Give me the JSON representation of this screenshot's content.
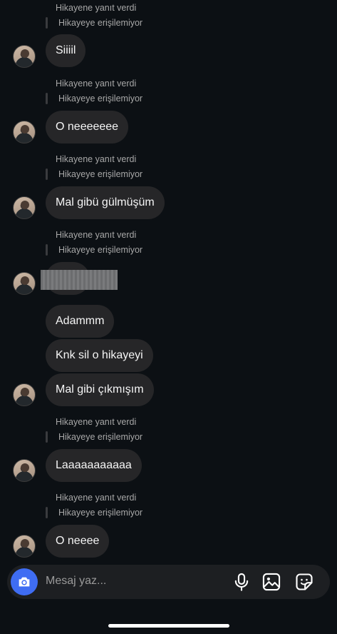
{
  "messages": [
    {
      "type": "story_reply",
      "reply": "Hikayene yanıt verdi",
      "unavailable": "Hikayeye erişilemiyor",
      "text": "Siiiil"
    },
    {
      "type": "story_reply",
      "reply": "Hikayene yanıt verdi",
      "unavailable": "Hikayeye erişilemiyor",
      "text": "O neeeeeee"
    },
    {
      "type": "story_reply",
      "reply": "Hikayene yanıt verdi",
      "unavailable": "Hikayeye erişilemiyor",
      "text": "Mal gibü gülmüşüm"
    },
    {
      "type": "story_reply",
      "reply": "Hikayene yanıt verdi",
      "unavailable": "Hikayeye erişilemiyor",
      "text": "",
      "redacted": true
    },
    {
      "type": "text",
      "text": "Adammm"
    },
    {
      "type": "text",
      "text": "Knk sil o hikayeyi"
    },
    {
      "type": "text",
      "text": "Mal gibi çıkmışım"
    },
    {
      "type": "story_reply",
      "reply": "Hikayene yanıt verdi",
      "unavailable": "Hikayeye erişilemiyor",
      "text": "Laaaaaaaaaaa"
    },
    {
      "type": "story_reply",
      "reply": "Hikayene yanıt verdi",
      "unavailable": "Hikayeye erişilemiyor",
      "text": "O neeee"
    }
  ],
  "composer": {
    "placeholder": "Mesaj yaz...",
    "icons": [
      "camera-icon",
      "microphone-icon",
      "gallery-icon",
      "sticker-icon"
    ]
  },
  "colors": {
    "background": "#0c1014",
    "bubble": "#262628",
    "camera_button": "#3f6df3",
    "secondary_text": "#a8a8a8"
  }
}
